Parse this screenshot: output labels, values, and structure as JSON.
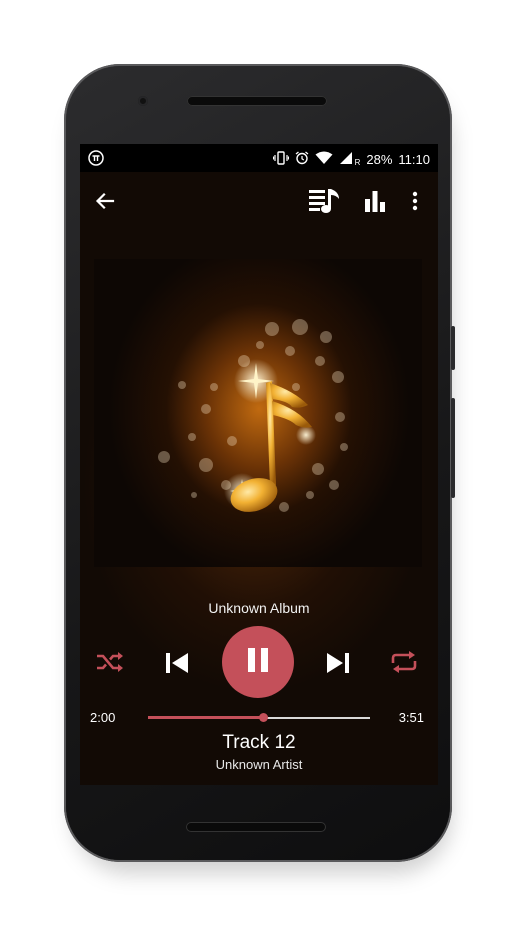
{
  "status_bar": {
    "app_icon": "pi-icon",
    "battery": "28%",
    "time": "11:10",
    "icons": [
      "vibrate-icon",
      "alarm-icon",
      "wifi-icon",
      "signal-icon"
    ],
    "roaming_label": "R"
  },
  "toolbar": {
    "back_icon": "arrow-back-icon",
    "actions": [
      "queue-music-icon",
      "equalizer-icon",
      "more-vert-icon"
    ]
  },
  "now_playing": {
    "album": "Unknown Album",
    "title": "Track 12",
    "artist": "Unknown Artist",
    "elapsed": "2:00",
    "duration": "3:51",
    "progress_fraction": 0.52
  },
  "controls": {
    "shuffle_icon": "shuffle-icon",
    "previous_icon": "skip-previous-icon",
    "play_pause_icon": "pause-icon",
    "next_icon": "skip-next-icon",
    "repeat_icon": "repeat-icon"
  },
  "colors": {
    "accent": "#c4505a",
    "background": "#120a05",
    "album_glow": "#e08a1a"
  }
}
